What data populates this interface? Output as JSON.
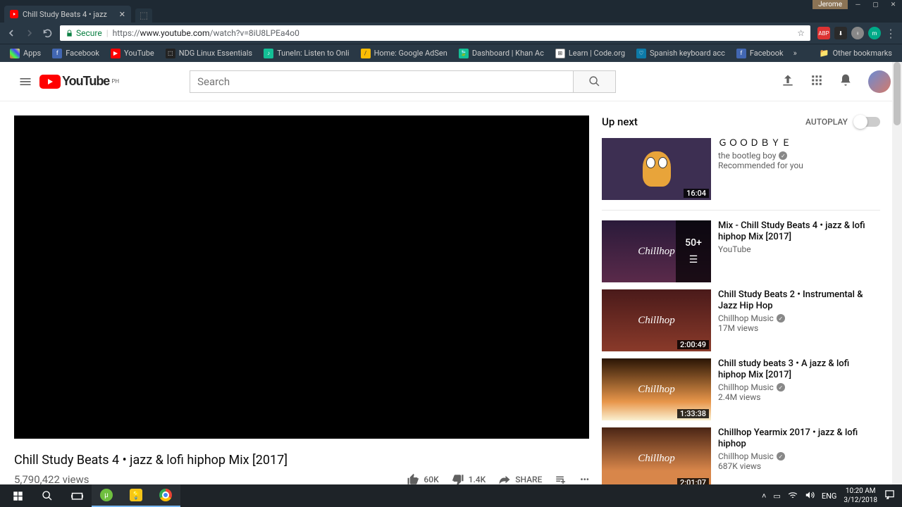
{
  "window": {
    "user": "Jerome"
  },
  "tab": {
    "title": "Chill Study Beats 4 • jazz"
  },
  "address": {
    "secure": "Secure",
    "protocol": "https://",
    "host": "www.youtube.com",
    "path": "/watch?v=8iU8LPEa4o0"
  },
  "bookmarks": [
    {
      "label": "Apps",
      "color": "#5f6368"
    },
    {
      "label": "Facebook",
      "color": "#4267B2"
    },
    {
      "label": "YouTube",
      "color": "#FF0000"
    },
    {
      "label": "NDG Linux Essentials",
      "color": "#333"
    },
    {
      "label": "TuneIn: Listen to Onli",
      "color": "#1db954"
    },
    {
      "label": "Home: Google AdSen",
      "color": "#fbbc04"
    },
    {
      "label": "Dashboard | Khan Ac",
      "color": "#14bf96"
    },
    {
      "label": "Learn | Code.org",
      "color": "#333"
    },
    {
      "label": "Spanish keyboard acc",
      "color": "#0d7aa8"
    },
    {
      "label": "Facebook",
      "color": "#4267B2"
    }
  ],
  "other_bookmarks": "Other bookmarks",
  "youtube": {
    "brand": "YouTube",
    "region": "PH",
    "search_placeholder": "Search"
  },
  "video": {
    "title": "Chill Study Beats 4 • jazz & lofi hiphop Mix [2017]",
    "views": "5,790,422 views",
    "likes": "60K",
    "dislikes": "1.4K",
    "share": "SHARE"
  },
  "sidebar": {
    "upnext": "Up next",
    "autoplay": "AUTOPLAY",
    "items": [
      {
        "title": "ＧＯＯＤＢＹＥ",
        "channel": "the bootleg boy",
        "meta": "Recommended for you",
        "duration": "16:04",
        "verified": true
      },
      {
        "title": "Mix - Chill Study Beats 4 • jazz & lofi hiphop Mix [2017]",
        "channel": "YouTube",
        "meta": "",
        "duration": "",
        "verified": false,
        "mix": "50+"
      },
      {
        "title": "Chill Study Beats 2 • Instrumental & Jazz Hip Hop",
        "channel": "Chillhop Music",
        "meta": "17M views",
        "duration": "2:00:49",
        "verified": true
      },
      {
        "title": "Chill study beats 3 • A jazz & lofi hiphop Mix [2017]",
        "channel": "Chillhop Music",
        "meta": "2.4M views",
        "duration": "1:33:38",
        "verified": true
      },
      {
        "title": "Chillhop Yearmix 2017 • jazz & lofi hiphop",
        "channel": "Chillhop Music",
        "meta": "687K views",
        "duration": "2:01:07",
        "verified": true
      }
    ]
  },
  "taskbar": {
    "lang": "ENG",
    "time": "10:20 AM",
    "date": "3/12/2018"
  }
}
